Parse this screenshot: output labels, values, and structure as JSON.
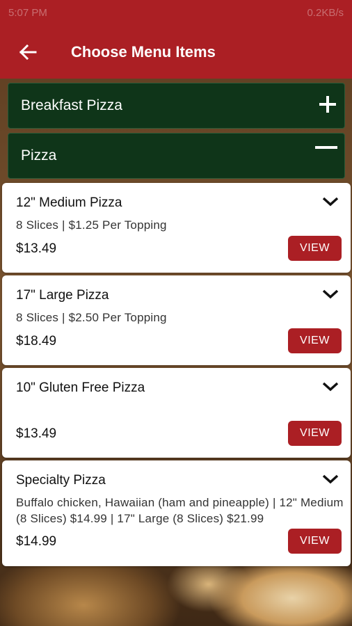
{
  "status_bar": {
    "time": "5:07 PM",
    "right": "0.2KB/s"
  },
  "header": {
    "title": "Choose Menu Items"
  },
  "categories": [
    {
      "label": "Breakfast Pizza",
      "toggle": "+"
    },
    {
      "label": "Pizza",
      "toggle": "−"
    }
  ],
  "items": [
    {
      "name": "12\" Medium Pizza",
      "description": "8 Slices | $1.25 Per Topping",
      "price": "$13.49",
      "button": "VIEW"
    },
    {
      "name": "17\" Large Pizza",
      "description": "8 Slices | $2.50 Per Topping",
      "price": "$18.49",
      "button": "VIEW"
    },
    {
      "name": "10\" Gluten Free Pizza",
      "description": "",
      "price": "$13.49",
      "button": "VIEW"
    },
    {
      "name": "Specialty Pizza",
      "description": "Buffalo chicken, Hawaiian (ham and pineapple) | 12\" Medium (8 Slices) $14.99 | 17\" Large (8 Slices) $21.99",
      "price": "$14.99",
      "button": "VIEW"
    }
  ],
  "colors": {
    "primary": "#ab1f24",
    "category_bg": "#0f3519"
  },
  "icons": {
    "back": "arrow-left",
    "expand": "plus",
    "collapse": "minus",
    "item_toggle": "chevron-down"
  }
}
